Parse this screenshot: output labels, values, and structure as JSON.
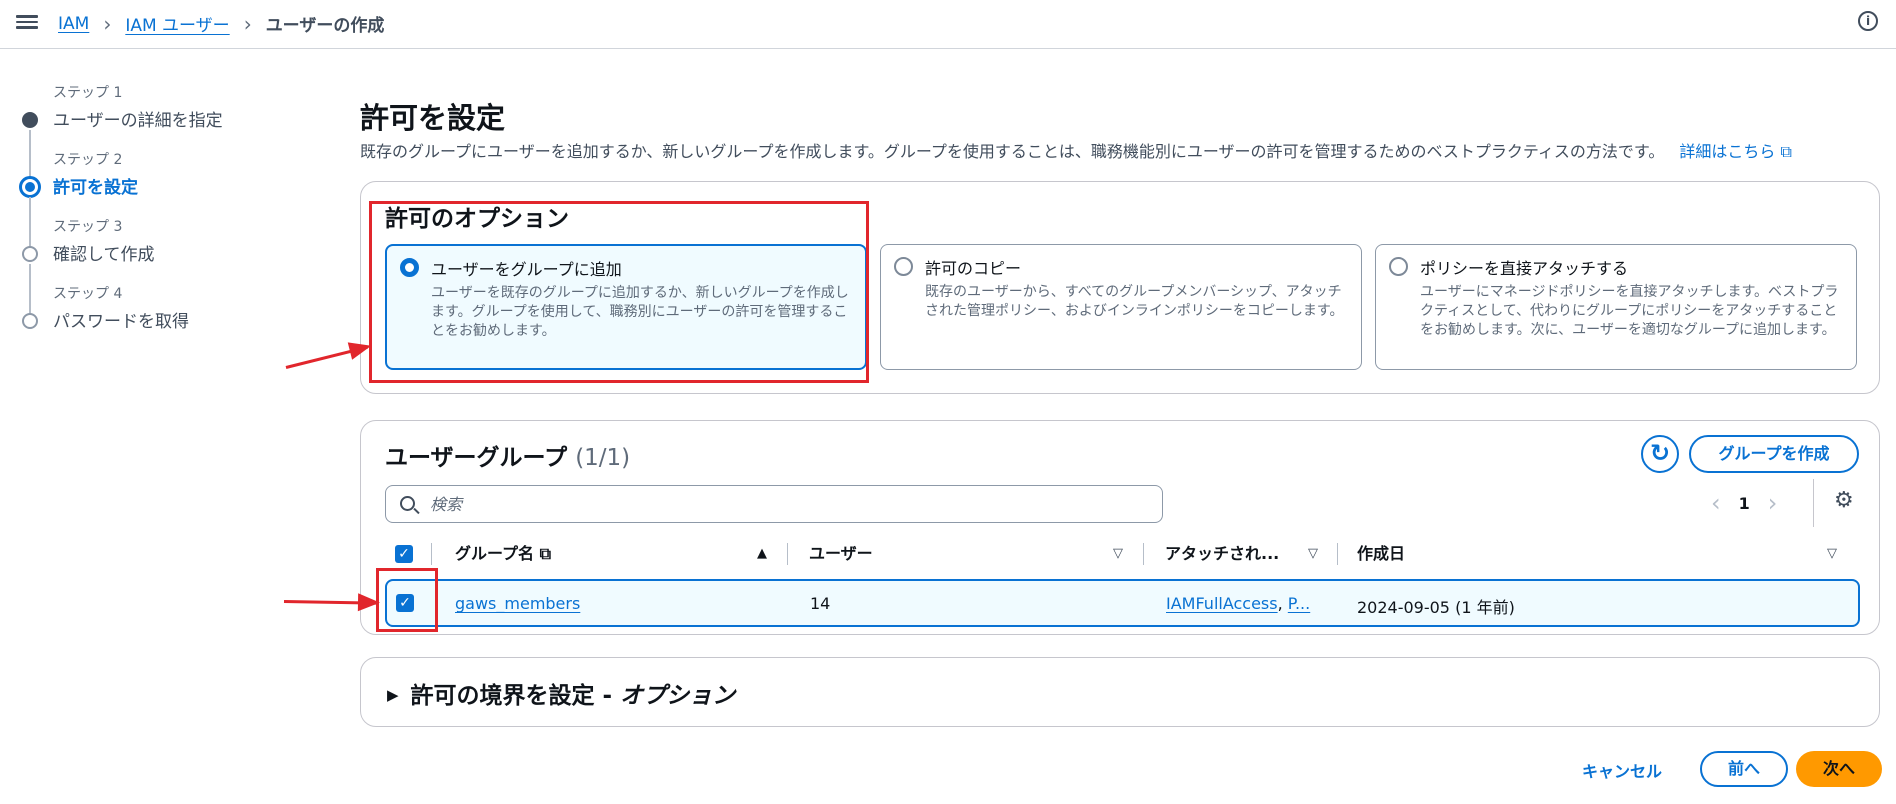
{
  "breadcrumb": {
    "items": [
      "IAM",
      "IAM ユーザー"
    ],
    "current": "ユーザーの作成"
  },
  "steps": [
    {
      "label": "ステップ 1",
      "title": "ユーザーの詳細を指定"
    },
    {
      "label": "ステップ 2",
      "title": "許可を設定"
    },
    {
      "label": "ステップ 3",
      "title": "確認して作成"
    },
    {
      "label": "ステップ 4",
      "title": "パスワードを取得"
    }
  ],
  "page": {
    "title": "許可を設定",
    "description": "既存のグループにユーザーを追加するか、新しいグループを作成します。グループを使用することは、職務機能別にユーザーの許可を管理するためのベストプラクティスの方法です。",
    "learn_more": "詳細はこちら"
  },
  "permission_options": {
    "title": "許可のオプション",
    "options": [
      {
        "label": "ユーザーをグループに追加",
        "desc": "ユーザーを既存のグループに追加するか、新しいグループを作成します。グループを使用して、職務別にユーザーの許可を管理することをお勧めします。",
        "selected": true
      },
      {
        "label": "許可のコピー",
        "desc": "既存のユーザーから、すべてのグループメンバーシップ、アタッチされた管理ポリシー、およびインラインポリシーをコピーします。",
        "selected": false
      },
      {
        "label": "ポリシーを直接アタッチする",
        "desc": "ユーザーにマネージドポリシーを直接アタッチします。ベストプラクティスとして、代わりにグループにポリシーをアタッチすることをお勧めします。次に、ユーザーを適切なグループに追加します。",
        "selected": false
      }
    ]
  },
  "user_groups": {
    "title": "ユーザーグループ",
    "count": "(1/1)",
    "create_button": "グループを作成",
    "search_placeholder": "検索",
    "page_number": "1",
    "columns": [
      "グループ名",
      "ユーザー",
      "アタッチされ...",
      "作成日"
    ],
    "rows": [
      {
        "name": "gaws_members",
        "users": "14",
        "policy1": "IAMFullAccess",
        "policy_sep": ",",
        "policy2": "P...",
        "created": "2024-09-05 (1 年前)"
      }
    ]
  },
  "boundary": {
    "title": "許可の境界を設定 - ",
    "title_option": "オプション"
  },
  "footer": {
    "cancel": "キャンセル",
    "prev": "前へ",
    "next": "次へ"
  },
  "colors": {
    "accent": "#0972d3",
    "primary_button": "#ff9900",
    "annotation": "#e1262c"
  }
}
